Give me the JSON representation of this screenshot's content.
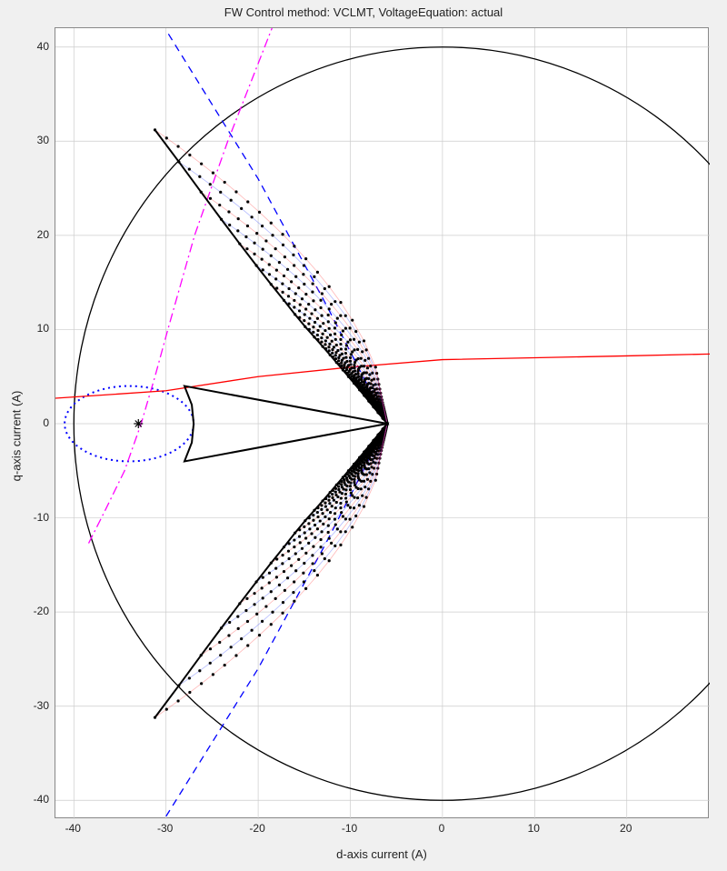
{
  "chart_data": {
    "type": "scatter",
    "title": "FW Control method: VCLMT, VoltageEquation: actual",
    "xlabel": "d-axis current (A)",
    "ylabel": "q-axis current (A)",
    "xlim": [
      -42,
      29
    ],
    "ylim": [
      -42,
      42
    ],
    "xticks": [
      -40,
      -30,
      -20,
      -10,
      0,
      10,
      20
    ],
    "yticks": [
      -40,
      -30,
      -20,
      -10,
      0,
      10,
      20,
      30,
      40
    ],
    "circles": [
      {
        "cx": 0,
        "cy": 0,
        "r": 40,
        "stroke": "#000000",
        "style": "solid"
      }
    ],
    "ellipses": [
      {
        "cx": -34,
        "cy": 0,
        "rx": 7,
        "ry": 4,
        "stroke": "#0000ff",
        "style": "dotted"
      }
    ],
    "lines": [
      {
        "stroke": "#0000ff",
        "style": "dashed",
        "points": [
          [
            -30,
            -41.7
          ],
          [
            -20,
            -26
          ],
          [
            -12.6,
            -12.6
          ],
          [
            -6,
            0
          ],
          [
            -12.6,
            12.6
          ],
          [
            -20,
            26
          ],
          [
            -30,
            41.8
          ]
        ]
      },
      {
        "stroke": "#ff00ff",
        "style": "dashdot",
        "points": [
          [
            -38.4,
            -12.7
          ],
          [
            -36.5,
            -9
          ],
          [
            -34.5,
            -5
          ],
          [
            -32.7,
            0
          ],
          [
            -31.2,
            5
          ],
          [
            -29.8,
            10
          ],
          [
            -26.9,
            20
          ],
          [
            -23.3,
            30
          ],
          [
            -20.5,
            37
          ],
          [
            -18.5,
            42
          ]
        ]
      },
      {
        "stroke": "#ff0000",
        "style": "solid",
        "points": [
          [
            -42,
            2.7
          ],
          [
            -30,
            3.5
          ],
          [
            -20,
            5
          ],
          [
            -10,
            6
          ],
          [
            0,
            6.8
          ],
          [
            10,
            7
          ],
          [
            20,
            7.2
          ],
          [
            29,
            7.4
          ]
        ]
      }
    ],
    "marker": {
      "x": -33,
      "y": 0,
      "symbol": "star"
    },
    "trajectories": {
      "arc_id_start": -6.0,
      "iq_targets": [
        0,
        0.6,
        1.2,
        1.8,
        2.4,
        3.0,
        3.6,
        4.3,
        5.0,
        5.7,
        6.5,
        7.3,
        8.2,
        9.2,
        10.3,
        11.6,
        13.1,
        14.8,
        16.8,
        19.1,
        21.7,
        24.6,
        27.8,
        31.2
      ],
      "id_targets": [
        -6.0,
        -6.5,
        -7.0,
        -7.5,
        -8.0,
        -8.5,
        -9.0,
        -9.6,
        -10.2,
        -10.8,
        -11.5,
        -12.2,
        -13.0,
        -13.9,
        -14.9,
        -16.0,
        -17.2,
        -18.6,
        -20.2,
        -22.0,
        -24.0,
        -26.2,
        -28.6,
        -31.2
      ],
      "samples_per_traj": 20,
      "description": "Fan-shaped family of trajectories (each with mirrored negative-iq counterpart) from arc center (-6,0) curving outward to operating points on the current-limit circle; black dot markers sampled along each."
    }
  }
}
